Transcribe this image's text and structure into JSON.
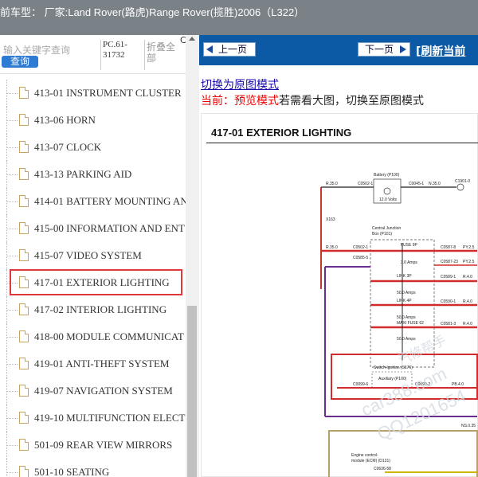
{
  "window": {
    "title": "前车型：  厂家:Land Rover(路虎)Range Rover(揽胜)2006（L322）"
  },
  "sidebar": {
    "search": {
      "placeholder": "输入关键字查询",
      "button": "查询"
    },
    "pc_code": "PC.61-31732",
    "collapse_label": "折叠全部",
    "corner_label": "C",
    "items": [
      {
        "label": "413-01 INSTRUMENT CLUSTER",
        "selected": false
      },
      {
        "label": "413-06 HORN",
        "selected": false
      },
      {
        "label": "413-07 CLOCK",
        "selected": false
      },
      {
        "label": "413-13 PARKING AID",
        "selected": false
      },
      {
        "label": "414-01 BATTERY MOUNTING AN",
        "selected": false
      },
      {
        "label": "415-00 INFORMATION AND ENT",
        "selected": false
      },
      {
        "label": "415-07 VIDEO SYSTEM",
        "selected": false
      },
      {
        "label": "417-01 EXTERIOR LIGHTING",
        "selected": true
      },
      {
        "label": "417-02 INTERIOR LIGHTING",
        "selected": false
      },
      {
        "label": "418-00 MODULE COMMUNICAT",
        "selected": false
      },
      {
        "label": "419-01 ANTI-THEFT SYSTEM",
        "selected": false
      },
      {
        "label": "419-07 NAVIGATION SYSTEM",
        "selected": false
      },
      {
        "label": "419-10 MULTIFUNCTION ELECT",
        "selected": false
      },
      {
        "label": "501-09 REAR VIEW MIRRORS",
        "selected": false
      },
      {
        "label": "501-10 SEATING",
        "selected": false
      }
    ],
    "selected_border_color": "#e0393b"
  },
  "viewer": {
    "prev_label": "上一页",
    "next_label": "下一页",
    "refresh_label": "[刷新当前",
    "switch_link": "切换为原图模式",
    "mode_current": "当前：预览模式",
    "mode_hint": "若需看大图，切换至原图模式",
    "nav_color": "#0c5aa6",
    "document": {
      "title": "417-01 EXTERIOR LIGHTING",
      "labels": {
        "battery": "Battery (P100)",
        "volts": "12.0 Volts",
        "cjb1": "Central Junction",
        "cjb2": "Box (P101)",
        "fuse": "FUSE 9P",
        "fuse_amps": "3.0 Amps",
        "link3": "LINK 3P",
        "link3_amps": "50.0 Amps",
        "link4": "LINK 4P",
        "link4_amps": "50.0 Amps",
        "maxi": "MAXI FUSE 62",
        "maxi_amps": "50.0 Amps",
        "ign": "Switch-Ignition (S176)",
        "aux": "Auxiliary (P100)",
        "ecm1": "Engine control-",
        "ecm2": "module (ECM) (D131)",
        "w1": "R.35.0",
        "w2": "N.35.0",
        "w3": "R.35.0",
        "w4": "R.35.0",
        "c1": "C0502-1",
        "c2": "C0045-1",
        "c3": "C1901-0",
        "c4": "C0502-1",
        "c5": "C0585-5",
        "r1": "C0587-8",
        "r2": "PY.2.5",
        "r3": "C0587-23",
        "r4": "PY.2.5",
        "r5": "C0589-1",
        "r6": "R.4.0",
        "r7": "C0590-1",
        "r8": "R.4.0",
        "r9": "C0581-3",
        "r10": "R.4.0",
        "s1": "C0099-6",
        "s2": "C0099-2",
        "s3": "PB.4.0",
        "e1": "C0636-58",
        "ns": "NS.0.35",
        "x": "X163"
      },
      "watermarks": [
        "汽修帮手",
        "car388.com",
        "QQ1201654"
      ]
    }
  }
}
